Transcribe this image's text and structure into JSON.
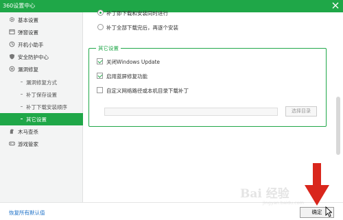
{
  "window": {
    "title": "360设置中心",
    "accent_color": "#1fa748"
  },
  "sidebar": {
    "items": [
      {
        "label": "基本设置",
        "icon": "gear-icon"
      },
      {
        "label": "弹窗设置",
        "icon": "window-icon"
      },
      {
        "label": "开机小助手",
        "icon": "clock-icon"
      },
      {
        "label": "安全防护中心",
        "icon": "shield-icon"
      },
      {
        "label": "漏洞修复",
        "icon": "repair-icon"
      },
      {
        "label": "漏洞修复方式"
      },
      {
        "label": "补丁保存设置"
      },
      {
        "label": "补丁下载安装顺序"
      },
      {
        "label": "其它设置",
        "selected": true
      },
      {
        "label": "木马查杀",
        "icon": "trojan-icon"
      },
      {
        "label": "游戏管家",
        "icon": "gamepad-icon"
      }
    ]
  },
  "main": {
    "radio_top_partial": "补丁即下载和安装同时进行",
    "radio_second": "补丁全部下载完后，再逐个安装",
    "group": {
      "title": "其它设置",
      "checkboxes": [
        {
          "label": "关闭Windows Update",
          "checked": true
        },
        {
          "label": "启用蓝屏修复功能",
          "checked": true
        },
        {
          "label": "自定义网络路径或本机目录下载补丁",
          "checked": false
        }
      ],
      "path_value": "",
      "browse_label": "选择目录"
    }
  },
  "footer": {
    "restore_label": "恢复所有默认值",
    "ok_label": "确定"
  },
  "watermark": {
    "line1": "Bai 经验",
    "line2": "jingyan.baidu.com"
  }
}
